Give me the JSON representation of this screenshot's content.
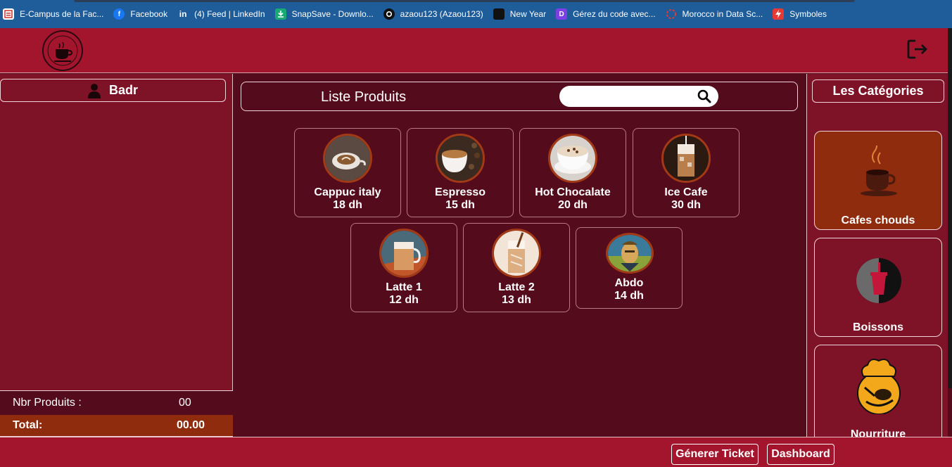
{
  "bookmarks": [
    {
      "label": "E-Campus de la Fac...",
      "icon": "campus-icon"
    },
    {
      "label": "Facebook",
      "icon": "facebook-icon"
    },
    {
      "label": "(4) Feed | LinkedIn",
      "icon": "linkedin-icon"
    },
    {
      "label": "SnapSave - Downlo...",
      "icon": "download-icon"
    },
    {
      "label": "azaou123 (Azaou123)",
      "icon": "github-icon"
    },
    {
      "label": "New Year",
      "icon": "calendar-icon"
    },
    {
      "label": "Gérez du code avec...",
      "icon": "code-icon"
    },
    {
      "label": "Morocco in Data Sc...",
      "icon": "ring-icon"
    },
    {
      "label": "Symboles",
      "icon": "lightning-icon"
    }
  ],
  "user": {
    "name": "Badr"
  },
  "products_panel": {
    "title": "Liste Produits",
    "search_placeholder": ""
  },
  "products": [
    {
      "name": "Cappuc italy",
      "price": "18 dh"
    },
    {
      "name": "Espresso",
      "price": "15 dh"
    },
    {
      "name": "Hot Chocalate",
      "price": "20 dh"
    },
    {
      "name": "Ice Cafe",
      "price": "30 dh"
    },
    {
      "name": "Latte 1",
      "price": "12 dh"
    },
    {
      "name": "Latte 2",
      "price": "13 dh"
    },
    {
      "name": "Abdo",
      "price": "14 dh"
    }
  ],
  "summary": {
    "count_label": "Nbr Produits :",
    "count_value": "00",
    "total_label": "Total:",
    "total_value": "00.00"
  },
  "categories": {
    "title": "Les Catégories",
    "items": [
      {
        "name": "Cafes chouds",
        "active": true
      },
      {
        "name": "Boissons",
        "active": false
      },
      {
        "name": "Nourriture",
        "active": false
      }
    ]
  },
  "footer": {
    "ticket_label": "Génerer Ticket",
    "dashboard_label": "Dashboard"
  },
  "colors": {
    "header": "#a3152d",
    "panel": "#7e1227",
    "center": "#540b1b",
    "accent": "#8f2c0e"
  }
}
